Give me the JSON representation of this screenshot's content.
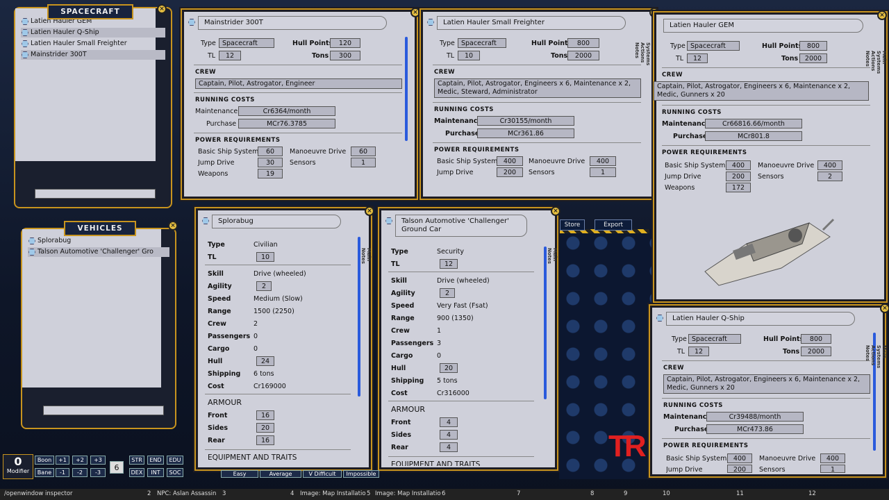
{
  "spacecraft_panel": {
    "title": "SPACECRAFT",
    "items": [
      "Latien Hauler GEM",
      "Latien Hauler Q-Ship",
      "Latien Hauler Small Freighter",
      "Mainstrider 300T"
    ]
  },
  "vehicles_panel": {
    "title": "VEHICLES",
    "items": [
      "Splorabug",
      "Talson Automotive 'Challenger' Gro"
    ]
  },
  "labels": {
    "type": "Type",
    "tl": "TL",
    "hull_points": "Hull Points",
    "tons": "Tons",
    "crew": "CREW",
    "running_costs": "RUNNING COSTS",
    "maintenance": "Maintenance",
    "purchase": "Purchase",
    "power_req": "POWER REQUIREMENTS",
    "basic": "Basic Ship Systems",
    "manoeuvre": "Manoeuvre Drive",
    "jump": "Jump Drive",
    "sensors": "Sensors",
    "weapons": "Weapons",
    "skill": "Skill",
    "agility": "Agility",
    "speed": "Speed",
    "range": "Range",
    "crew_v": "Crew",
    "passengers": "Passengers",
    "cargo": "Cargo",
    "hull": "Hull",
    "shipping": "Shipping",
    "cost": "Cost",
    "armour": "ARMOUR",
    "front": "Front",
    "sides": "Sides",
    "rear": "Rear",
    "equipment": "EQUIPMENT AND TRAITS",
    "tab_main": "Main",
    "tab_systems": "Systems",
    "tab_actions": "Actions",
    "tab_notes": "Notes"
  },
  "mainstrider": {
    "name": "Mainstrider 300T",
    "type": "Spacecraft",
    "tl": "12",
    "hull_points": "120",
    "tons": "300",
    "crew": "Captain, Pilot, Astrogator, Engineer",
    "maintenance": "Cr6364/month",
    "purchase": "MCr76.3785",
    "basic": "60",
    "manoeuvre": "60",
    "jump": "30",
    "sensors": "1",
    "weapons": "19"
  },
  "small_freighter": {
    "name": "Latien Hauler Small Freighter",
    "type": "Spacecraft",
    "tl": "10",
    "hull_points": "800",
    "tons": "2000",
    "crew": "Captain, Pilot, Astrogator, Engineers x 6, Maintenance x 2, Medic, Steward, Administrator",
    "maintenance": "Cr30155/month",
    "purchase": "MCr361.86",
    "basic": "400",
    "manoeuvre": "400",
    "jump": "200",
    "sensors": "1"
  },
  "gem": {
    "name": "Latien Hauler GEM",
    "type": "Spacecraft",
    "tl": "12",
    "hull_points": "800",
    "tons": "2000",
    "crew": "Captain, Pilot, Astrogator, Engineers x 6, Maintenance x 2, Medic, Gunners x 20",
    "maintenance": "Cr66816.66/month",
    "purchase": "MCr801.8",
    "basic": "400",
    "manoeuvre": "400",
    "jump": "200",
    "sensors": "2",
    "weapons": "172"
  },
  "qship": {
    "name": "Latien Hauler Q-Ship",
    "type": "Spacecraft",
    "tl": "12",
    "hull_points": "800",
    "tons": "2000",
    "crew": "Captain, Pilot, Astrogator, Engineers x 6, Maintenance x 2, Medic, Gunners x 20",
    "maintenance": "Cr39488/month",
    "purchase": "MCr473.86",
    "basic": "400",
    "manoeuvre": "400",
    "jump": "200",
    "sensors": "1"
  },
  "splorabug": {
    "name": "Splorabug",
    "type": "Civilian",
    "tl": "10",
    "skill": "Drive (wheeled)",
    "agility": "2",
    "speed": "Medium (Slow)",
    "range": "1500 (2250)",
    "crew": "2",
    "passengers": "0",
    "cargo": "0",
    "hull": "24",
    "shipping": "6 tons",
    "cost": "Cr169000",
    "front": "16",
    "sides": "20",
    "rear": "16"
  },
  "challenger": {
    "name": "Talson Automotive 'Challenger' Ground Car",
    "type": "Security",
    "tl": "12",
    "skill": "Drive (wheeled)",
    "agility": "2",
    "speed": "Very Fast (Fsat)",
    "range": "900 (1350)",
    "crew": "1",
    "passengers": "3",
    "cargo": "0",
    "hull": "20",
    "shipping": "5 tons",
    "cost": "Cr316000",
    "front": "4",
    "sides": "4",
    "rear": "4"
  },
  "buttons": {
    "store": "Store",
    "export": "Export"
  },
  "dice_bar": {
    "modifier_value": "0",
    "modifier_label": "Modifier",
    "boon": "Boon",
    "bane": "Bane",
    "plus1": "+1",
    "plus2": "+2",
    "plus3": "+3",
    "minus1": "-1",
    "minus2": "-2",
    "minus3": "-3",
    "six": "6",
    "str": "STR",
    "end": "END",
    "edu": "EDU",
    "dex": "DEX",
    "int": "INT",
    "soc": "SOC",
    "easy": "Easy",
    "average": "Average",
    "vdifficult": "V Difficult",
    "impossible": "Impossible"
  },
  "hotkeys": {
    "h1": "/openwindow inspector",
    "h2": "NPC: Aslan Assassin",
    "h3": "Image: Map Installatio",
    "h4": "Image: Map Installatio",
    "n2": "2",
    "n3": "3",
    "n4": "4",
    "n5": "5",
    "n6": "6",
    "n7": "7",
    "n8": "8",
    "n9": "9",
    "n10": "10",
    "n11": "11",
    "n12": "12"
  },
  "logo": "TR"
}
